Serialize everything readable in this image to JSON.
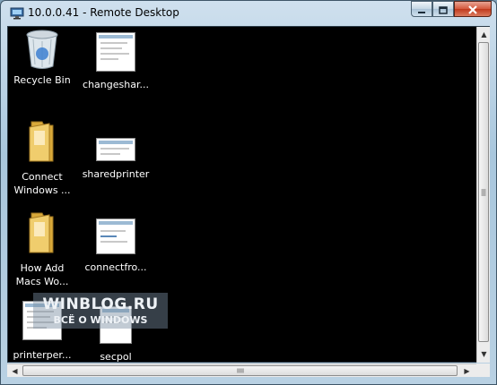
{
  "window": {
    "title": "10.0.0.41 - Remote Desktop",
    "buttons": {
      "minimize_icon": "minimize-icon",
      "maximize_icon": "maximize-icon",
      "close_icon": "close-icon"
    }
  },
  "desktop": {
    "icons": [
      {
        "label": "Recycle Bin",
        "icon": "recycle-bin-icon"
      },
      {
        "label": "changeshar...",
        "icon": "document-thumbnail-icon"
      },
      {
        "label": "Connect Windows ...",
        "icon": "folder-icon"
      },
      {
        "label": "sharedprinter",
        "icon": "document-thumbnail-icon"
      },
      {
        "label": "How Add Macs Wo...",
        "icon": "folder-icon"
      },
      {
        "label": "connectfro...",
        "icon": "document-thumbnail-icon"
      },
      {
        "label": "printerper...",
        "icon": "document-thumbnail-icon"
      },
      {
        "label": "secpol",
        "icon": "document-thumbnail-icon"
      }
    ]
  },
  "watermark": {
    "line1": "WINBLOG.RU",
    "line2": "ВСЁ О WINDOWS"
  },
  "colors": {
    "desktop_background": "#000000",
    "frame": "#b9d1e3",
    "close_button": "#c0391c"
  }
}
